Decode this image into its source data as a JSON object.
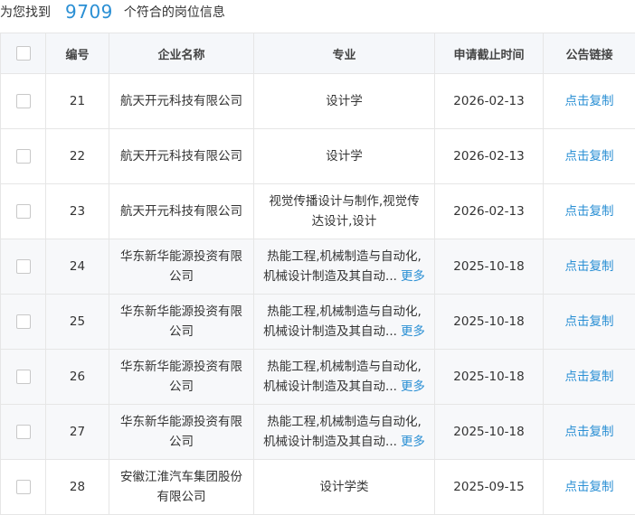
{
  "summary": {
    "prefix": "为您找到",
    "count": "9709",
    "suffix": "个符合的岗位信息"
  },
  "headers": {
    "number": "编号",
    "company": "企业名称",
    "major": "专业",
    "deadline": "申请截止时间",
    "link": "公告链接"
  },
  "rows": [
    {
      "number": "21",
      "company": "航天开元科技有限公司",
      "major_line1": "设计学",
      "major_line2": "",
      "more": "",
      "deadline": "2026-02-13",
      "link": "点击复制"
    },
    {
      "number": "22",
      "company": "航天开元科技有限公司",
      "major_line1": "设计学",
      "major_line2": "",
      "more": "",
      "deadline": "2026-02-13",
      "link": "点击复制"
    },
    {
      "number": "23",
      "company": "航天开元科技有限公司",
      "major_line1": "视觉传播设计与制作,视觉传",
      "major_line2": "达设计,设计",
      "more": "",
      "deadline": "2026-02-13",
      "link": "点击复制"
    },
    {
      "number": "24",
      "company": "华东新华能源投资有限公司",
      "major_line1": "热能工程,机械制造与自动化,",
      "major_line2": "机械设计制造及其自动...",
      "more": "更多",
      "deadline": "2025-10-18",
      "link": "点击复制"
    },
    {
      "number": "25",
      "company": "华东新华能源投资有限公司",
      "major_line1": "热能工程,机械制造与自动化,",
      "major_line2": "机械设计制造及其自动...",
      "more": "更多",
      "deadline": "2025-10-18",
      "link": "点击复制"
    },
    {
      "number": "26",
      "company": "华东新华能源投资有限公司",
      "major_line1": "热能工程,机械制造与自动化,",
      "major_line2": "机械设计制造及其自动...",
      "more": "更多",
      "deadline": "2025-10-18",
      "link": "点击复制"
    },
    {
      "number": "27",
      "company": "华东新华能源投资有限公司",
      "major_line1": "热能工程,机械制造与自动化,",
      "major_line2": "机械设计制造及其自动...",
      "more": "更多",
      "deadline": "2025-10-18",
      "link": "点击复制"
    },
    {
      "number": "28",
      "company": "安徽江淮汽车集团股份有限公司",
      "major_line1": "设计学类",
      "major_line2": "",
      "more": "",
      "deadline": "2025-09-15",
      "link": "点击复制"
    }
  ]
}
